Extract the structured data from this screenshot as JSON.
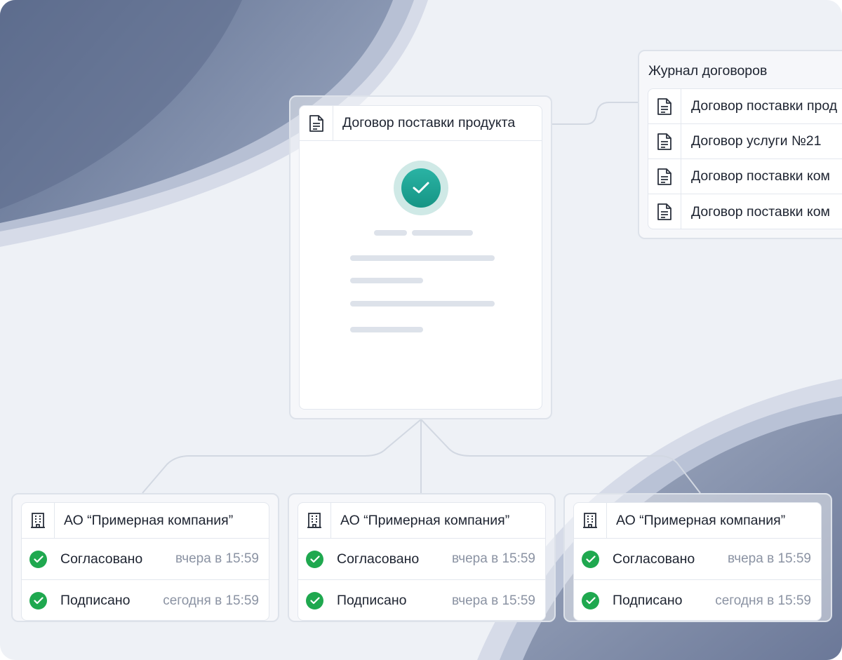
{
  "document": {
    "title": "Договор поставки продукта",
    "icon": "document-icon",
    "status_icon": "check-icon"
  },
  "journal": {
    "title": "Журнал договоров",
    "items": [
      {
        "label": "Договор поставки прод",
        "icon": "document-icon"
      },
      {
        "label": "Договор услуги №21",
        "icon": "document-icon"
      },
      {
        "label": "Договор поставки ком",
        "icon": "document-icon"
      },
      {
        "label": "Договор поставки ком",
        "icon": "document-icon"
      }
    ]
  },
  "companies": [
    {
      "name": "АО “Примерная компания”",
      "icon": "building-icon",
      "steps": [
        {
          "label": "Согласовано",
          "time": "вчера в 15:59"
        },
        {
          "label": "Подписано",
          "time": "сегодня  в 15:59"
        }
      ]
    },
    {
      "name": "АО “Примерная компания”",
      "icon": "building-icon",
      "steps": [
        {
          "label": "Согласовано",
          "time": "вчера в 15:59"
        },
        {
          "label": "Подписано",
          "time": "вчера в 15:59"
        }
      ]
    },
    {
      "name": "АО “Примерная компания”",
      "icon": "building-icon",
      "steps": [
        {
          "label": "Согласовано",
          "time": "вчера в 15:59"
        },
        {
          "label": "Подписано",
          "time": "сегодня  в 15:59"
        }
      ]
    }
  ],
  "colors": {
    "background": "#eef1f6",
    "wave": "#7584a3",
    "accent_teal": "#1fa597",
    "status_green": "#1fa84f"
  }
}
